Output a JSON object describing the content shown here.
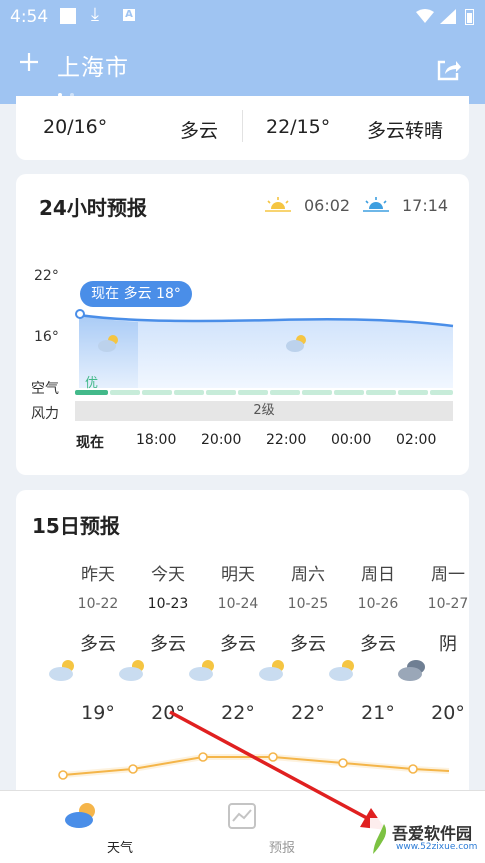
{
  "status_bar": {
    "time": "4:54"
  },
  "header": {
    "city": "上海市",
    "add_icon": "plus-icon",
    "share_icon": "share-icon"
  },
  "top_card": [
    {
      "temp": "20/16°",
      "weather": "多云"
    },
    {
      "temp": "22/15°",
      "weather": "多云转晴"
    }
  ],
  "hourly": {
    "title": "24小时预报",
    "sunrise": "06:02",
    "sunset": "17:14",
    "temp_high_label": "22°",
    "temp_low_label": "16°",
    "now_badge": "现在 多云 18°",
    "air_label": "空气",
    "wind_label": "风力",
    "aqi_text": "优",
    "wind_text": "2级",
    "hours": [
      "现在",
      "18:00",
      "20:00",
      "22:00",
      "00:00",
      "02:00"
    ]
  },
  "daily": {
    "title": "15日预报",
    "days": [
      {
        "name": "昨天",
        "date": "10-22",
        "weather": "多云",
        "high": "19°",
        "icon": "cloudy-sun-icon"
      },
      {
        "name": "今天",
        "date": "10-23",
        "weather": "多云",
        "high": "20°",
        "icon": "cloudy-sun-icon"
      },
      {
        "name": "明天",
        "date": "10-24",
        "weather": "多云",
        "high": "22°",
        "icon": "cloudy-sun-icon"
      },
      {
        "name": "周六",
        "date": "10-25",
        "weather": "多云",
        "high": "22°",
        "icon": "cloudy-sun-icon"
      },
      {
        "name": "周日",
        "date": "10-26",
        "weather": "多云",
        "high": "21°",
        "icon": "cloudy-sun-icon"
      },
      {
        "name": "周一",
        "date": "10-27",
        "weather": "阴",
        "high": "20°",
        "icon": "overcast-icon"
      }
    ]
  },
  "bottom_nav": [
    {
      "label": "天气",
      "icon": "weather-icon",
      "active": true
    },
    {
      "label": "预报",
      "icon": "chart-icon",
      "active": false
    }
  ],
  "watermark": {
    "text": "吾爱软件园",
    "url": "www.52zixue.com"
  },
  "colors": {
    "accent": "#4a8ee8",
    "header": "#9fc4f2",
    "temp_line": "#f5b54a",
    "aqi_good": "#43b98a"
  }
}
